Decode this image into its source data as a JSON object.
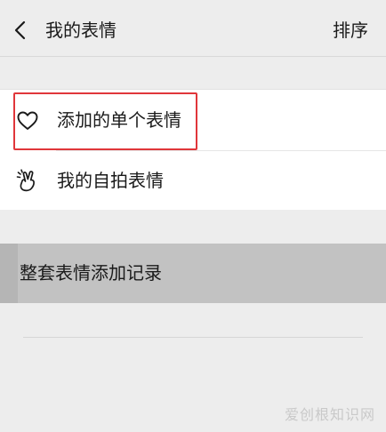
{
  "header": {
    "title": "我的表情",
    "sort_label": "排序"
  },
  "list": {
    "items": [
      {
        "label": "添加的单个表情",
        "icon": "heart-icon"
      },
      {
        "label": "我的自拍表情",
        "icon": "selfie-hand-icon"
      }
    ]
  },
  "record": {
    "label": "整套表情添加记录"
  },
  "watermark": {
    "text": "爱创根知识网"
  },
  "colors": {
    "background": "#ededed",
    "highlight": "#e0363a",
    "record_bar": "#c2c2c2"
  }
}
